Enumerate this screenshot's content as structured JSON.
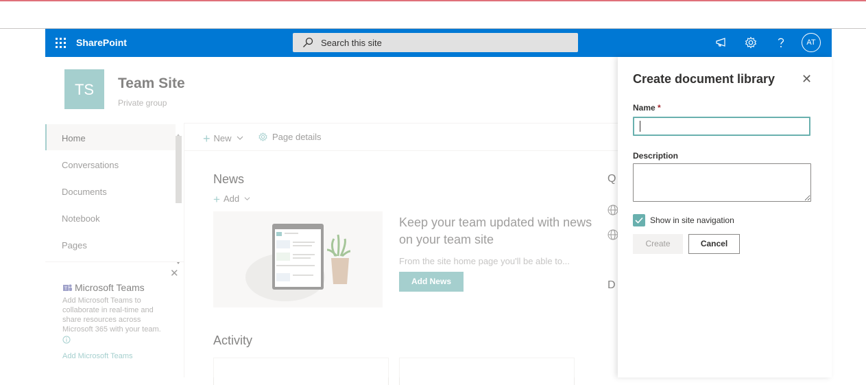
{
  "suite_bar": {
    "brand": "SharePoint",
    "search_placeholder": "Search this site",
    "avatar_initials": "AT",
    "accent": "#0078d4"
  },
  "site": {
    "logo_initials": "TS",
    "title": "Team Site",
    "subtitle": "Private group",
    "logo_color": "#69b0ae"
  },
  "leftnav": {
    "items": [
      {
        "label": "Home",
        "active": true
      },
      {
        "label": "Conversations"
      },
      {
        "label": "Documents"
      },
      {
        "label": "Notebook"
      },
      {
        "label": "Pages"
      }
    ]
  },
  "teams_promo": {
    "title": "Microsoft Teams",
    "description": "Add Microsoft Teams to collaborate in real-time and share resources across Microsoft 365 with your team.",
    "link": "Add Microsoft Teams"
  },
  "command_bar": {
    "new_label": "New",
    "page_details_label": "Page details"
  },
  "news": {
    "heading": "News",
    "add_label": "Add",
    "headline": "Keep your team updated with news on your team site",
    "body": "From the site home page you'll be able to...",
    "button": "Add News"
  },
  "activity": {
    "heading": "Activity"
  },
  "side_webparts": {
    "quick_links_initial": "Q",
    "documents_initial": "D"
  },
  "panel": {
    "title": "Create document library",
    "name_label": "Name",
    "required_marker": "*",
    "name_value": "",
    "description_label": "Description",
    "description_value": "",
    "show_in_nav_label": "Show in site navigation",
    "show_in_nav_checked": true,
    "create_button": "Create",
    "cancel_button": "Cancel"
  }
}
